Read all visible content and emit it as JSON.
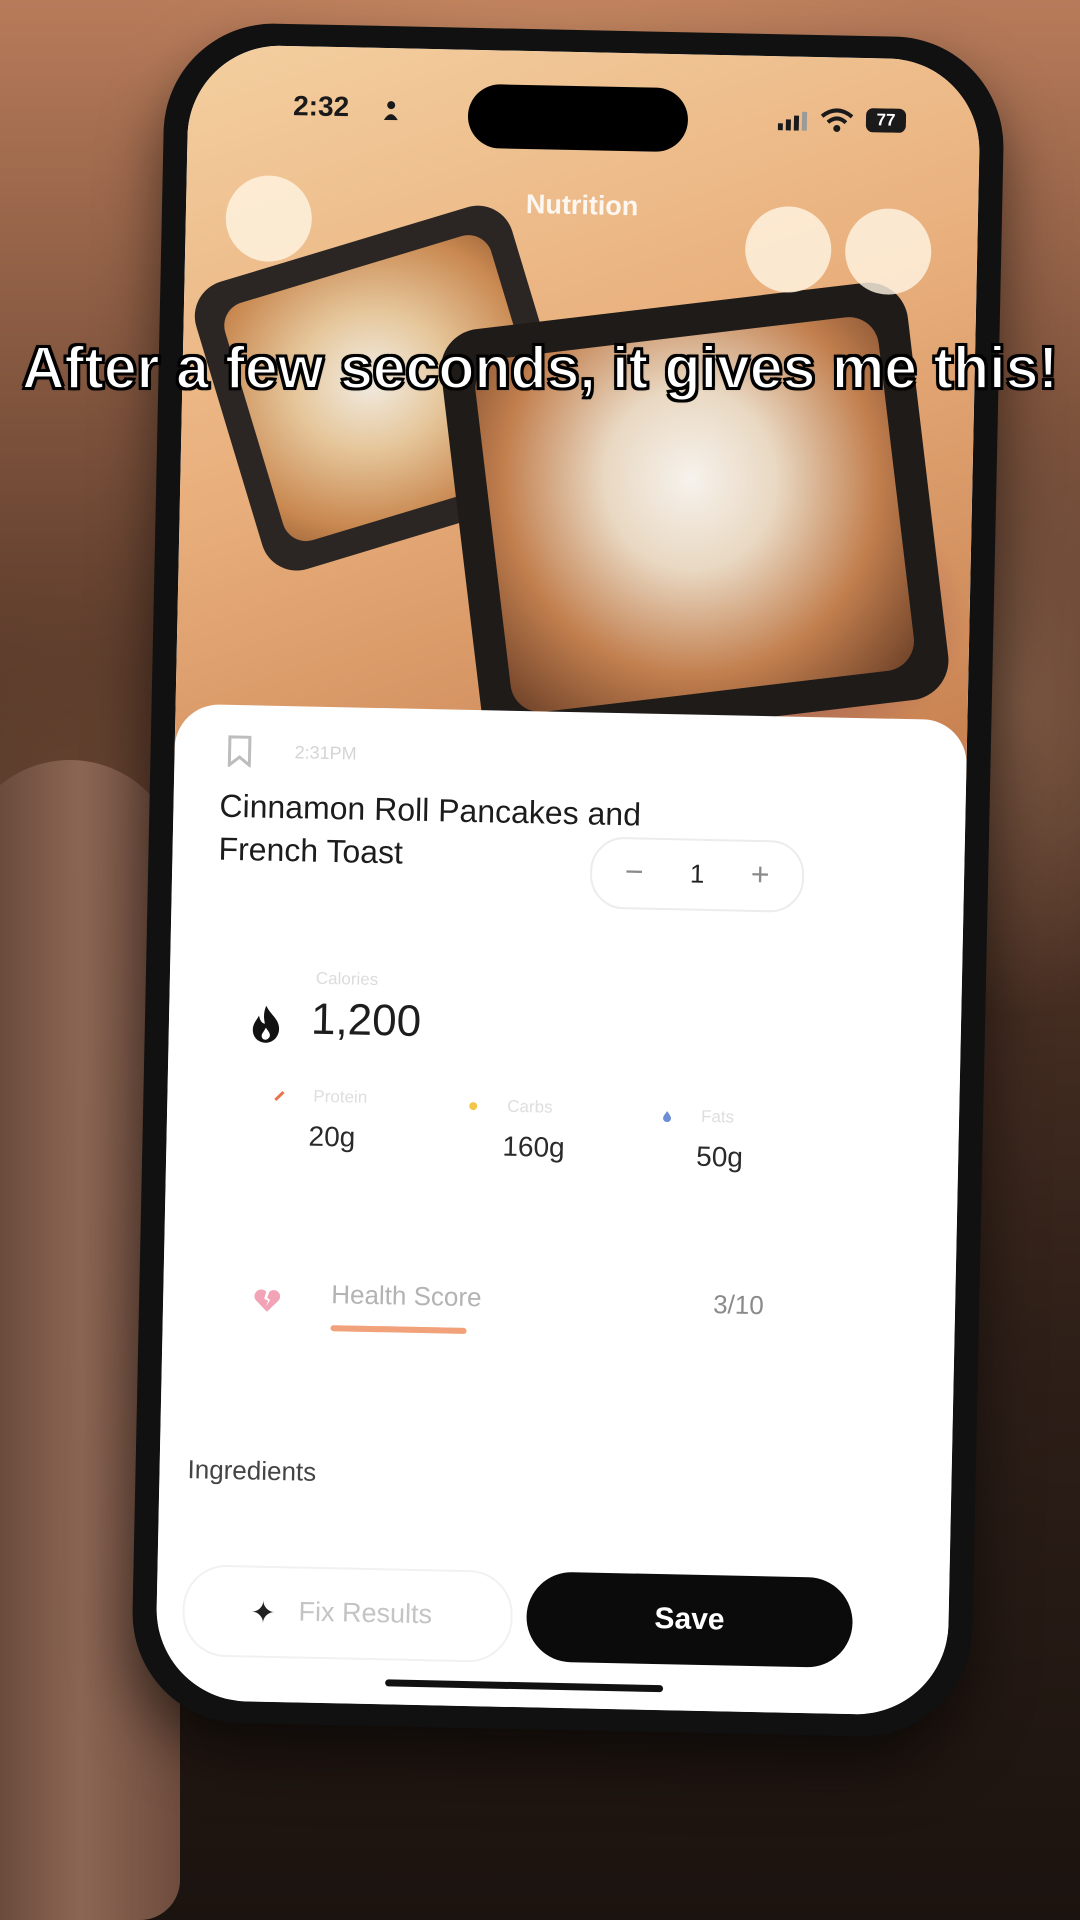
{
  "status_bar": {
    "time": "2:32",
    "battery": "77"
  },
  "header": {
    "title": "Nutrition"
  },
  "card": {
    "time": "2:31PM",
    "food_name": "Cinnamon Roll Pancakes and French Toast",
    "quantity": "1",
    "calories_label": "Calories",
    "calories_value": "1,200",
    "macros": [
      {
        "label": "Protein",
        "value": "20g",
        "color": "#e8744b"
      },
      {
        "label": "Carbs",
        "value": "160g",
        "color": "#f1c64a"
      },
      {
        "label": "Fats",
        "value": "50g",
        "color": "#6d8fd8"
      }
    ],
    "health_label": "Health Score",
    "health_score": "3/10",
    "health_fraction": 0.3,
    "ingredients_label": "Ingredients",
    "fix_label": "Fix Results",
    "save_label": "Save"
  },
  "caption": "After a few seconds, it gives me this!",
  "colors": {
    "accent_orange": "#f2a27a",
    "button_dark": "#0b0b0b"
  }
}
